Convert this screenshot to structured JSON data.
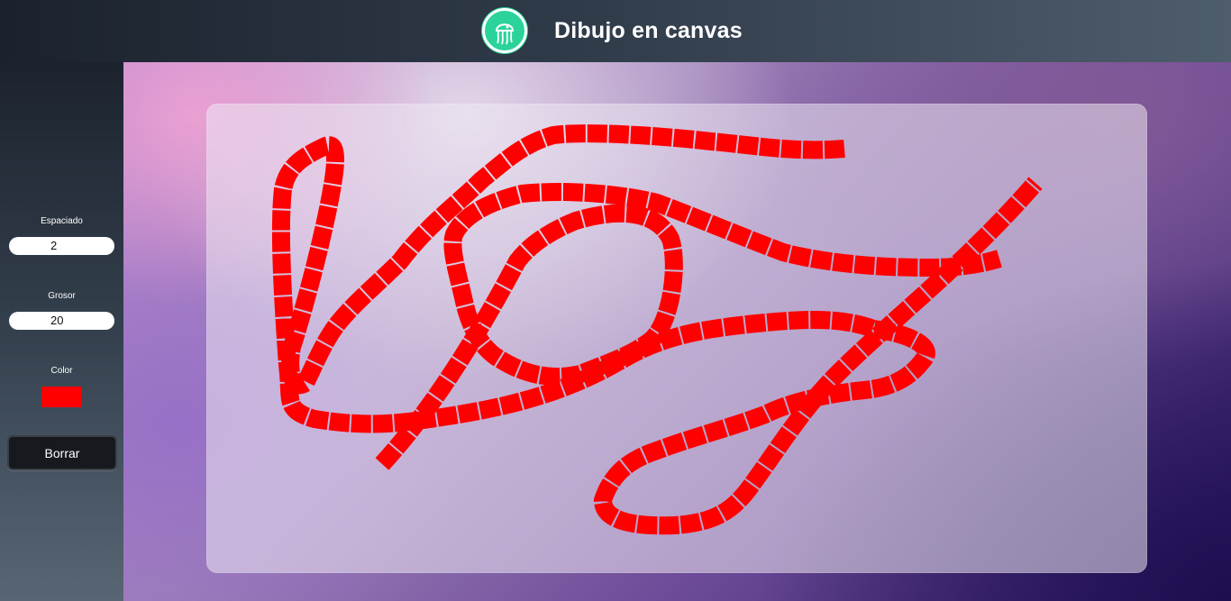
{
  "header": {
    "title": "Dibujo en canvas",
    "logo_icon": "jellyfish-icon"
  },
  "controls": {
    "spacing": {
      "label": "Espaciado",
      "value": "2"
    },
    "thickness": {
      "label": "Grosor",
      "value": "20"
    },
    "color": {
      "label": "Color",
      "value": "#ff0000"
    },
    "clear_label": "Borrar"
  },
  "canvas": {
    "stroke_color": "#ff0000",
    "stroke_width": 20
  },
  "colors": {
    "accent": "#2bd39a",
    "stroke": "#ff0000"
  }
}
